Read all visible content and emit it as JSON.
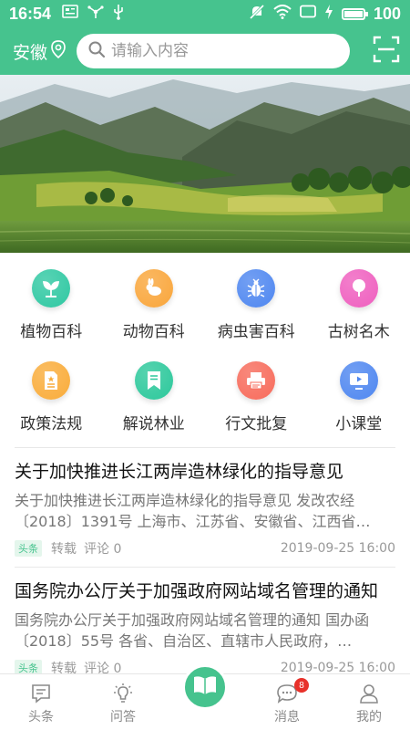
{
  "status_bar": {
    "time": "16:54",
    "battery": "100",
    "battery_level": 1.0,
    "icons": [
      "sim-card-icon",
      "usb-tether-icon",
      "usb-icon",
      "mute-icon",
      "wifi-icon",
      "cast-icon",
      "charging-icon",
      "battery-icon"
    ]
  },
  "header": {
    "location": "安徽",
    "search_placeholder": "请输入内容"
  },
  "colors": {
    "brand": "#46c38e",
    "badge": "#e8312a"
  },
  "categories": [
    {
      "label": "植物百科",
      "icon": "plant-icon",
      "color": "#2fc8a2"
    },
    {
      "label": "动物百科",
      "icon": "rabbit-icon",
      "color": "#f9a63b"
    },
    {
      "label": "病虫害百科",
      "icon": "bug-icon",
      "color": "#4f87f0"
    },
    {
      "label": "古树名木",
      "icon": "tree-icon",
      "color": "#ef5fbf"
    },
    {
      "label": "政策法规",
      "icon": "document-icon",
      "color": "#f9ac3a"
    },
    {
      "label": "解说林业",
      "icon": "bookmark-icon",
      "color": "#2cc89b"
    },
    {
      "label": "行文批复",
      "icon": "printer-icon",
      "color": "#f76b5b"
    },
    {
      "label": "小课堂",
      "icon": "video-icon",
      "color": "#4f87f0"
    }
  ],
  "news": [
    {
      "title": "关于加快推进长江两岸造林绿化的指导意见",
      "desc": "关于加快推进长江两岸造林绿化的指导意见 发改农经〔2018〕1391号 上海市、江苏省、安徽省、江西省…",
      "tag": "头条",
      "repost": "转载",
      "comments": "评论 0",
      "date": "2019-09-25 16:00"
    },
    {
      "title": "国务院办公厅关于加强政府网站域名管理的通知",
      "desc": "国务院办公厅关于加强政府网站域名管理的通知 国办函〔2018〕55号 各省、自治区、直辖市人民政府，…",
      "tag": "头条",
      "repost": "转载",
      "comments": "评论 0",
      "date": "2019-09-25 16:00"
    }
  ],
  "tabbar": {
    "headlines": "头条",
    "qa": "问答",
    "messages": "消息",
    "messages_badge": "8",
    "mine": "我的"
  }
}
